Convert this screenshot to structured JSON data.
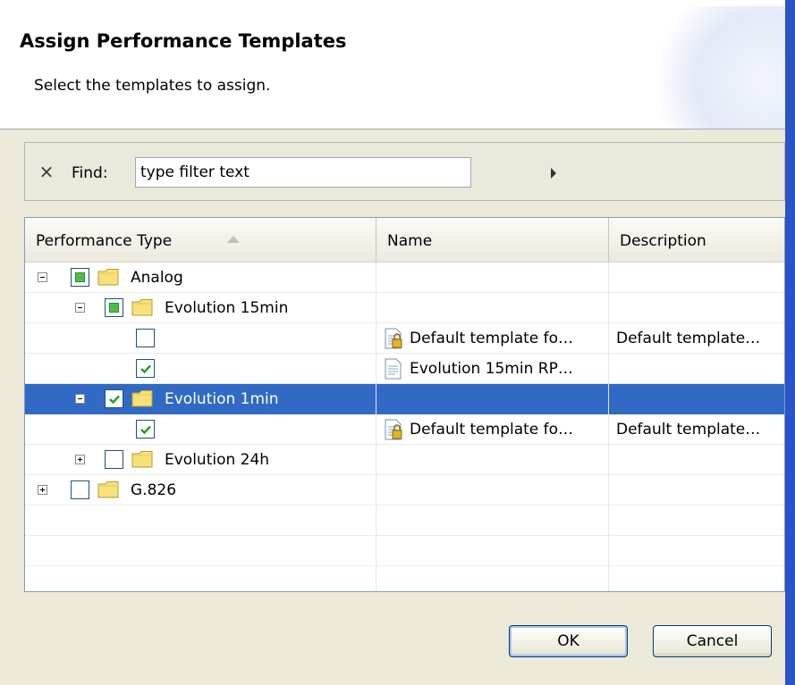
{
  "dialog": {
    "title": "Assign Performance Templates",
    "subtitle": "Select the templates to assign."
  },
  "filter": {
    "clear_icon": "×",
    "label": "Find:",
    "value": "type filter text"
  },
  "table": {
    "columns": {
      "type": "Performance Type",
      "name": "Name",
      "description": "Description"
    },
    "sort_column": "Performance Type",
    "sort_direction": "ascending",
    "rows": [
      {
        "label": "Analog",
        "name": "",
        "description": "",
        "check": "partial",
        "expander": "expanded",
        "kind": "folder"
      },
      {
        "label": "Evolution 15min",
        "name": "",
        "description": "",
        "check": "partial",
        "expander": "expanded",
        "kind": "folder"
      },
      {
        "label": "",
        "name": "Default template fo…",
        "description": "Default template…",
        "check": "unchecked",
        "kind": "locked-template"
      },
      {
        "label": "",
        "name": "Evolution 15min RP…",
        "description": "",
        "check": "checked",
        "kind": "template"
      },
      {
        "label": "Evolution 1min",
        "name": "",
        "description": "",
        "check": "checked",
        "expander": "expanded",
        "kind": "folder",
        "selected": true
      },
      {
        "label": "",
        "name": "Default template fo…",
        "description": "Default template…",
        "check": "checked",
        "kind": "locked-template"
      },
      {
        "label": "Evolution 24h",
        "name": "",
        "description": "",
        "check": "unchecked",
        "expander": "collapsed",
        "kind": "folder"
      },
      {
        "label": "G.826",
        "name": "",
        "description": "",
        "check": "unchecked",
        "expander": "collapsed",
        "kind": "folder"
      }
    ]
  },
  "buttons": {
    "ok": "OK",
    "cancel": "Cancel"
  },
  "colors": {
    "selection": "#316ac5",
    "check_green": "#21a121",
    "folder_yellow": "#f7e27a"
  }
}
